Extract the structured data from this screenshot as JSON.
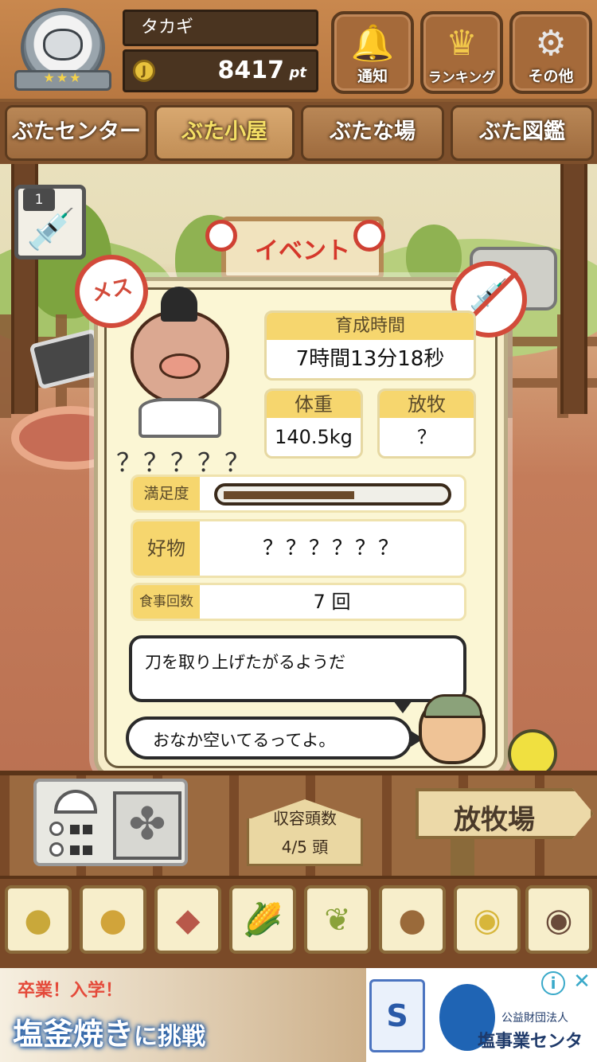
{
  "header": {
    "player_name": "タカギ",
    "points_value": "8417",
    "points_unit": "pt",
    "coin_glyph": "J",
    "rank_stars": "★★★",
    "buttons": [
      {
        "label": "通知",
        "icon": "bell-icon"
      },
      {
        "label": "ランキング",
        "icon": "crown-icon"
      },
      {
        "label": "その他",
        "icon": "gear-icon"
      }
    ]
  },
  "nav": {
    "tabs": [
      {
        "label": "ぶたセンター",
        "active": false
      },
      {
        "label": "ぶた小屋",
        "active": true
      },
      {
        "label": "ぶたな場",
        "active": false
      },
      {
        "label": "ぶた図鑑",
        "active": false
      }
    ]
  },
  "scene": {
    "event_sign": "イベント",
    "item_count": "1"
  },
  "pig": {
    "gender_label": "メス",
    "name": "？？？？？",
    "growth_time_label": "育成時間",
    "growth_time_value": "7時間13分18秒",
    "weight_label": "体重",
    "weight_value": "140.5kg",
    "grazing_label": "放牧",
    "grazing_value": "？",
    "satisfaction_label": "満足度",
    "satisfaction_level": 0.58,
    "favorite_label": "好物",
    "favorite_value": "？？？？？？",
    "meals_label": "食事回数",
    "meals_value": "7 回",
    "comment": "刀を取り上げたがるようだ",
    "farmer_message": "おなか空いてるってよ。"
  },
  "lower": {
    "capacity_label": "収容頭数",
    "capacity_value": "4/5 頭",
    "pasture_sign": "放牧場"
  },
  "food_items": [
    {
      "icon": "grain-pile-icon"
    },
    {
      "icon": "mixed-grain-icon"
    },
    {
      "icon": "sweet-potato-icon"
    },
    {
      "icon": "corn-icon"
    },
    {
      "icon": "soybean-icon"
    },
    {
      "icon": "acorn-icon"
    },
    {
      "icon": "grain-plate-icon"
    },
    {
      "icon": "meatball-plate-icon"
    }
  ],
  "ad": {
    "tagline": "卒業！入学！",
    "headline_part1": "塩釜焼き",
    "headline_part2": "に挑戦",
    "org_small": "公益財団法人",
    "org_name": "塩事業センター",
    "info_glyph": "i",
    "close_glyph": "✕"
  },
  "colors": {
    "accent_yellow": "#f6d66e",
    "alert_red": "#d24a3a",
    "wood_brown": "#7a4a28"
  }
}
